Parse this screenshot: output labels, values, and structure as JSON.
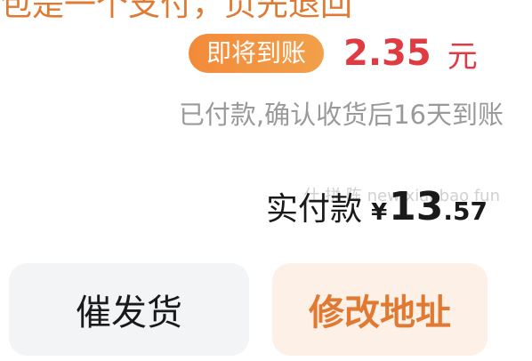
{
  "top_cut_text": "包是一个支付，页先退回",
  "arrival": {
    "badge_label": "即将到账",
    "amount": "2.35",
    "unit": "元"
  },
  "status_text": "已付款,确认收货后16天到账",
  "paid": {
    "label": "实付款",
    "currency": "¥",
    "amount_int": "13",
    "amount_dec": ".57"
  },
  "watermark": "什 拼 陈 new xianbao fun",
  "buttons": {
    "urge_label": "催发货",
    "modify_label": "修改地址"
  },
  "colors": {
    "accent_orange": "#e07a33",
    "price_red": "#e03b42",
    "muted_gray": "#9a9a9a"
  }
}
